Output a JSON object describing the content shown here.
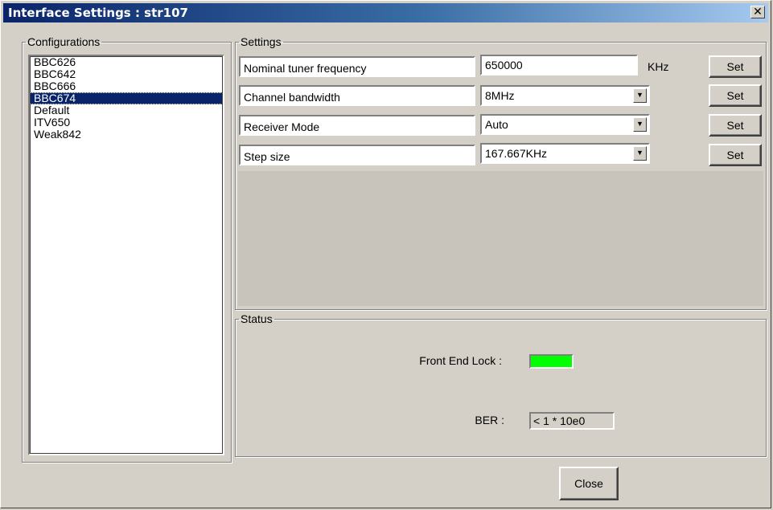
{
  "window": {
    "title": "Interface Settings : str107",
    "close_glyph": "✕"
  },
  "configurations": {
    "legend": "Configurations",
    "items": [
      "BBC626",
      "BBC642",
      "BBC666",
      "BBC674",
      "Default",
      "ITV650",
      "Weak842"
    ],
    "selected_index": 3
  },
  "settings": {
    "legend": "Settings",
    "rows": [
      {
        "label": "Nominal tuner frequency",
        "value": "650000",
        "unit": "KHz",
        "button": "Set",
        "type": "text"
      },
      {
        "label": "Channel bandwidth",
        "value": "8MHz",
        "unit": "",
        "button": "Set",
        "type": "combo"
      },
      {
        "label": "Receiver Mode",
        "value": "Auto",
        "unit": "",
        "button": "Set",
        "type": "combo"
      },
      {
        "label": "Step size",
        "value": "167.667KHz",
        "unit": "",
        "button": "Set",
        "type": "combo"
      }
    ]
  },
  "status": {
    "legend": "Status",
    "front_end_lock_label": "Front End Lock :",
    "front_end_lock_color": "#00ff00",
    "ber_label": "BER :",
    "ber_value": "< 1 * 10e0"
  },
  "footer": {
    "close_label": "Close"
  },
  "icons": {
    "combo_arrow": "▼"
  }
}
